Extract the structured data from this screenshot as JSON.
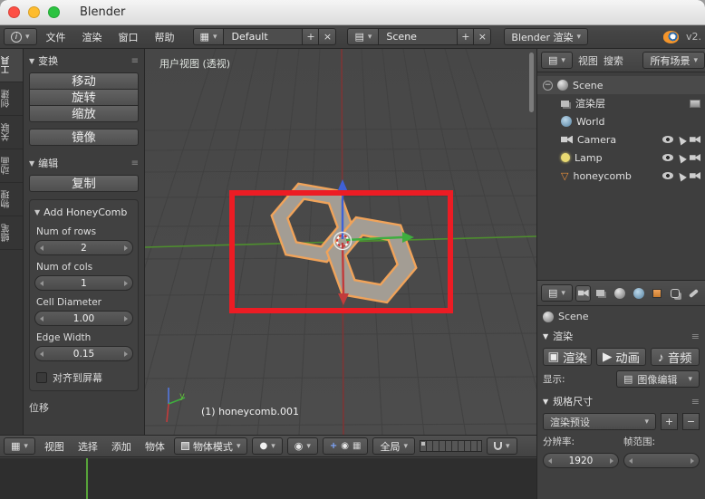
{
  "window": {
    "title": "Blender"
  },
  "icons": {
    "dropdown": "▾",
    "plus": "+",
    "close": "×",
    "menu": "≡",
    "section_open": "▼",
    "grid": "▦",
    "layers": "▤",
    "sphere": "●",
    "pivot": "◉",
    "collapse": "−",
    "info": "i",
    "camera_btn": "▣",
    "anim_btn": "▶",
    "audio_btn": "♪",
    "mesh": "▽"
  },
  "menubar": {
    "menus": [
      "文件",
      "渲染",
      "窗口",
      "帮助"
    ],
    "layout_value": "Default",
    "scene_value": "Scene",
    "engine_value": "Blender 渲染",
    "version": "v2."
  },
  "tabstrip": {
    "tabs": [
      "工具",
      "创建",
      "关联",
      "动画",
      "物理",
      "蜡笔"
    ]
  },
  "toolshelf": {
    "transform_title": "变换",
    "transform_buttons": [
      "移动",
      "旋转",
      "缩放",
      "镜像"
    ],
    "edit_title": "编辑",
    "edit_buttons": [
      "复制"
    ],
    "panel": {
      "title": "Add HoneyComb",
      "fields": [
        {
          "label": "Num of rows",
          "value": "2"
        },
        {
          "label": "Num of cols",
          "value": "1"
        },
        {
          "label": "Cell Diameter",
          "value": "1.00"
        },
        {
          "label": "Edge Width",
          "value": "0.15"
        }
      ],
      "checkbox_label": "对齐到屏幕",
      "footer_label": "位移"
    }
  },
  "viewport": {
    "view_label": "用户视图 (透视)",
    "object_info": "(1) honeycomb.001",
    "axis_y_label": "y"
  },
  "vp_header": {
    "menus": [
      "视图",
      "选择",
      "添加",
      "物体"
    ],
    "mode_value": "物体模式",
    "orientation_value": "全局"
  },
  "outliner": {
    "view_label": "视图",
    "search_label": "搜索",
    "scope_value": "所有场景",
    "tree": [
      {
        "label": "Scene"
      },
      {
        "label": "渲染层"
      },
      {
        "label": "World"
      },
      {
        "label": "Camera"
      },
      {
        "label": "Lamp"
      },
      {
        "label": "honeycomb"
      }
    ]
  },
  "properties": {
    "breadcrumb": "Scene",
    "render_title": "渲染",
    "render_buttons": [
      "渲染",
      "动画",
      "音频"
    ],
    "display_label": "显示:",
    "display_value": "图像编辑",
    "dims_title": "规格尺寸",
    "preset_value": "渲染预设",
    "resolution_label": "分辨率:",
    "frame_label": "帧范围:",
    "resolution_x": "1920"
  },
  "colors": {
    "selection_orange": "#f0a35a",
    "annotation_red": "#ec1c24",
    "axis_green": "#4e8f2e",
    "axis_red": "#7d3535"
  }
}
